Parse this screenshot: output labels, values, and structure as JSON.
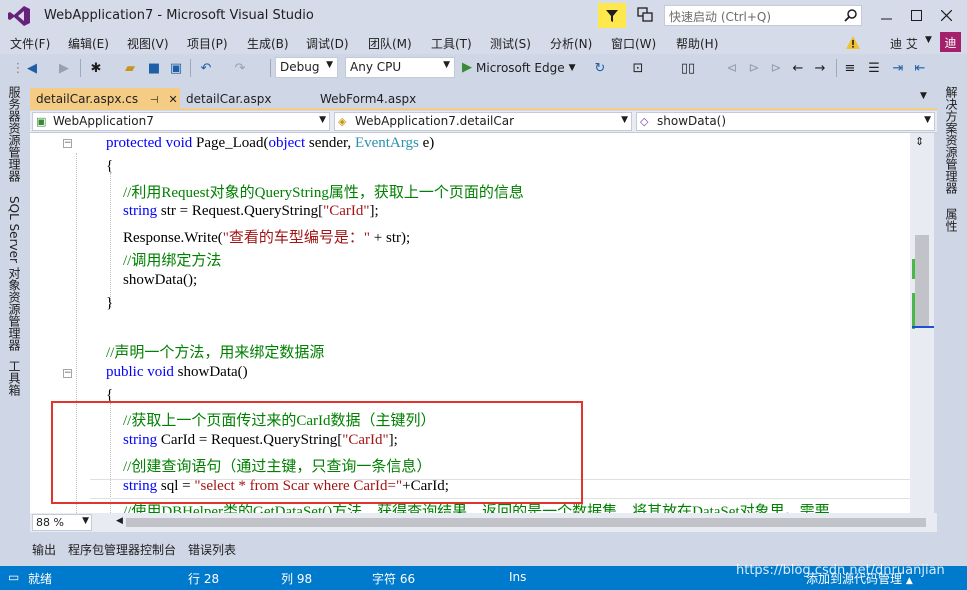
{
  "window": {
    "title": "WebApplication7 - Microsoft Visual Studio",
    "quick_launch_placeholder": "快速启动 (Ctrl+Q)",
    "user_name": "迪 艾",
    "user_avatar": "迪"
  },
  "menu": [
    "文件(F)",
    "编辑(E)",
    "视图(V)",
    "项目(P)",
    "生成(B)",
    "调试(D)",
    "团队(M)",
    "工具(T)",
    "测试(S)",
    "分析(N)",
    "窗口(W)",
    "帮助(H)"
  ],
  "toolbar": {
    "configuration": "Debug",
    "platform": "Any CPU",
    "run_target": "Microsoft Edge"
  },
  "left_panels": [
    "服务器资源管理器",
    "SQL Server 对象资源管理器",
    "工具箱"
  ],
  "right_panels": [
    "解决方案资源管理器",
    "属性"
  ],
  "doc_tabs": [
    {
      "label": "detailCar.aspx.cs",
      "active": true
    },
    {
      "label": "detailCar.aspx",
      "active": false
    },
    {
      "label": "WebForm4.aspx",
      "active": false
    }
  ],
  "navbar": {
    "project": "WebApplication7",
    "class": "WebApplication7.detailCar",
    "member": "showData()"
  },
  "code": {
    "l1_kw1": "protected",
    "l1_kw2": "void",
    "l1_rest": " Page_Load(",
    "l1_kw3": "object",
    "l1_rest2": " sender, ",
    "l1_typ": "EventArgs",
    "l1_rest3": " e)",
    "l2": "{",
    "l3": "//利用Request对象的QueryString属性，获取上一个页面的信息",
    "l4_kw": "string",
    "l4_rest": " str = Request.QueryString[",
    "l4_str": "\"CarId\"",
    "l4_end": "];",
    "l5_pre": "Response.Write(",
    "l5_str": "\"查看的车型编号是：\"",
    "l5_end": " + str);",
    "l6": "//调用绑定方法",
    "l7": "showData();",
    "l8": "}",
    "l9": "//声明一个方法，用来绑定数据源",
    "l10_kw1": "public",
    "l10_kw2": "void",
    "l10_rest": " showData()",
    "l11": "{",
    "l12": "//获取上一个页面传过来的CarId数据（主键列）",
    "l13_kw": "string",
    "l13_rest": " CarId = Request.QueryString[",
    "l13_str": "\"CarId\"",
    "l13_end": "];",
    "l14": "//创建查询语句（通过主键，只查询一条信息）",
    "l15_kw": "string",
    "l15_rest": " sql = ",
    "l15_str": "\"select * from Scar where CarId=\"",
    "l15_end": "+CarId;",
    "l16": "//使用DBHelper类的GetDataSet()方法，获得查询结果，返回的是一个数据集，将其放在DataSet对象里。需要"
  },
  "zoom": "88 %",
  "output_tabs": [
    "输出",
    "程序包管理器控制台",
    "错误列表"
  ],
  "status": {
    "ready": "就绪",
    "line": "行 28",
    "col": "列 98",
    "char": "字符 66",
    "mode": "Ins",
    "source_control": "添加到源代码管理"
  },
  "watermark": "https://blog.csdn.net/dnruanjian",
  "colors": {
    "accent": "#007acc",
    "tab_active": "#f5cc84",
    "highlight_box": "#e0342d",
    "avatar": "#a5206b"
  }
}
